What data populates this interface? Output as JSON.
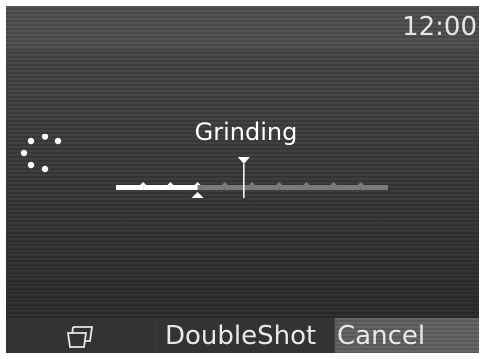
{
  "status_bar": {
    "time": "12:00"
  },
  "main": {
    "status_text": "Grinding",
    "spinner_icon": "loading-spinner-icon",
    "progress": {
      "value": 0.3,
      "target_marker": 0.47,
      "segments": 10
    }
  },
  "softkeys": {
    "cup_icon": "coffee-cup-icon",
    "double_shot_label": "DoubleShot",
    "cancel_label": "Cancel"
  },
  "colors": {
    "progress_filled": "#ffffff",
    "progress_empty": "#7a7a7a",
    "cancel_background": "#5e5e5e"
  }
}
